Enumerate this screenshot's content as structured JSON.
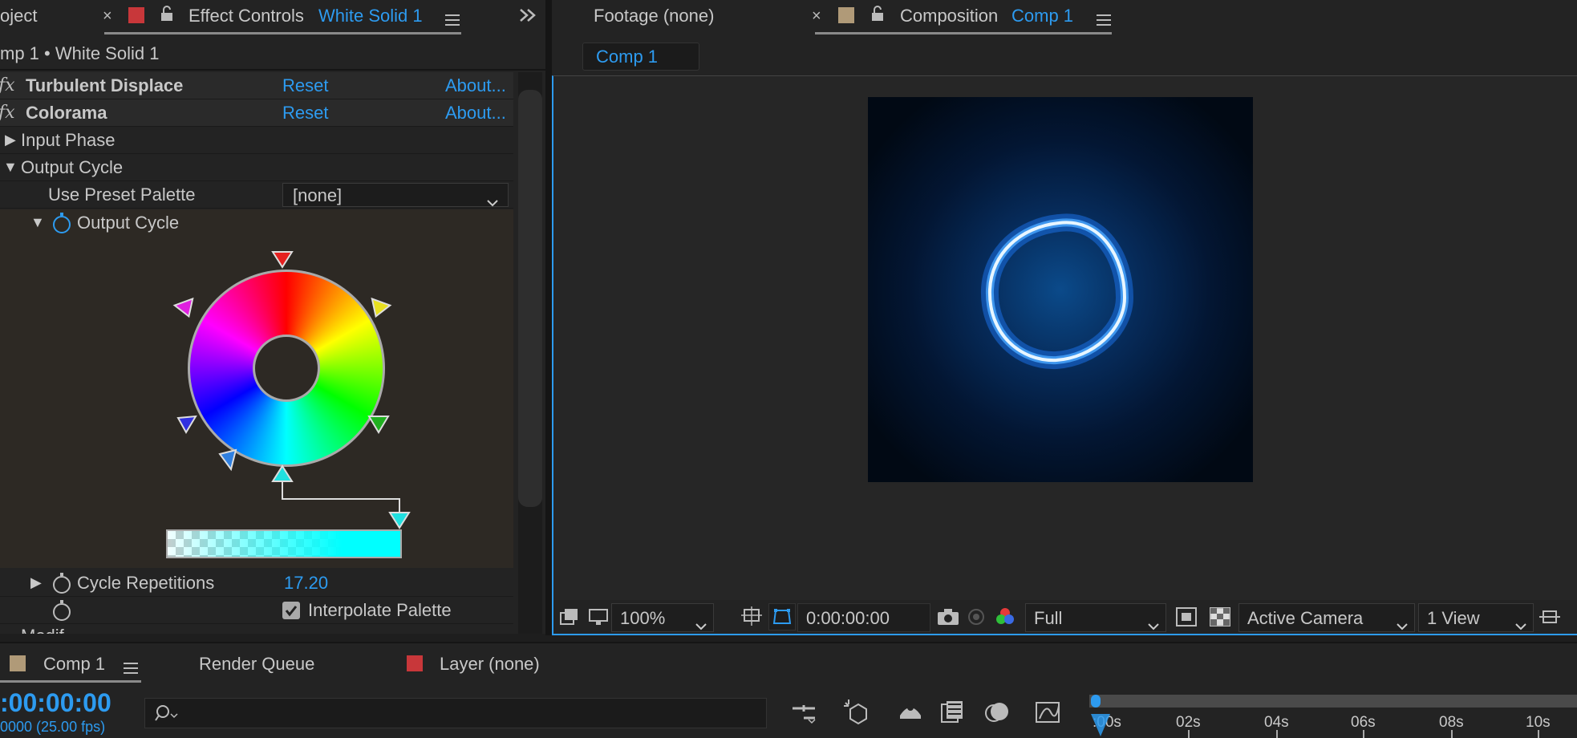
{
  "effect_panel": {
    "tab_project": "oject",
    "tab_close": "×",
    "tab_title": "Effect Controls",
    "tab_layer": "White Solid 1",
    "breadcrumb": "mp 1 • White Solid 1",
    "effects": [
      {
        "name": "Turbulent Displace",
        "reset": "Reset",
        "about": "About..."
      },
      {
        "name": "Colorama",
        "reset": "Reset",
        "about": "About..."
      }
    ],
    "input_phase": "Input Phase",
    "output_cycle": "Output Cycle",
    "use_preset_palette_label": "Use Preset Palette",
    "use_preset_palette_value": "[none]",
    "output_cycle_sub": "Output Cycle",
    "cycle_repetitions_label": "Cycle Repetitions",
    "cycle_repetitions_value": "17.20",
    "interpolate_palette_label": "Interpolate Palette",
    "cut_off_row": "Modif..."
  },
  "comp_panel": {
    "tab_footage": "Footage (none)",
    "tab_close": "×",
    "tab_composition": "Composition",
    "tab_comp_name": "Comp 1",
    "comp_chip": "Comp 1",
    "zoom": "100%",
    "timecode": "0:00:00:00",
    "resolution": "Full",
    "camera": "Active Camera",
    "views": "1 View"
  },
  "timeline": {
    "tabs": [
      "Comp 1",
      "Render Queue",
      "Layer (none)"
    ],
    "timecode": ":00:00:00",
    "frame_info": "0000 (25.00 fps)",
    "search_placeholder": "",
    "ruler_labels": [
      ":00s",
      "02s",
      "04s",
      "06s",
      "08s",
      "10s"
    ]
  },
  "colors": {
    "accent": "#2d9bf0",
    "panel_bg": "#232323",
    "effect_red": "#c8373a",
    "comp_tan": "#b09a78"
  },
  "icons": [
    "close-icon",
    "lock-icon",
    "menu-icon",
    "stopwatch-icon",
    "chevron-down-icon",
    "checkbox-icon",
    "camera-icon",
    "search-icon"
  ]
}
